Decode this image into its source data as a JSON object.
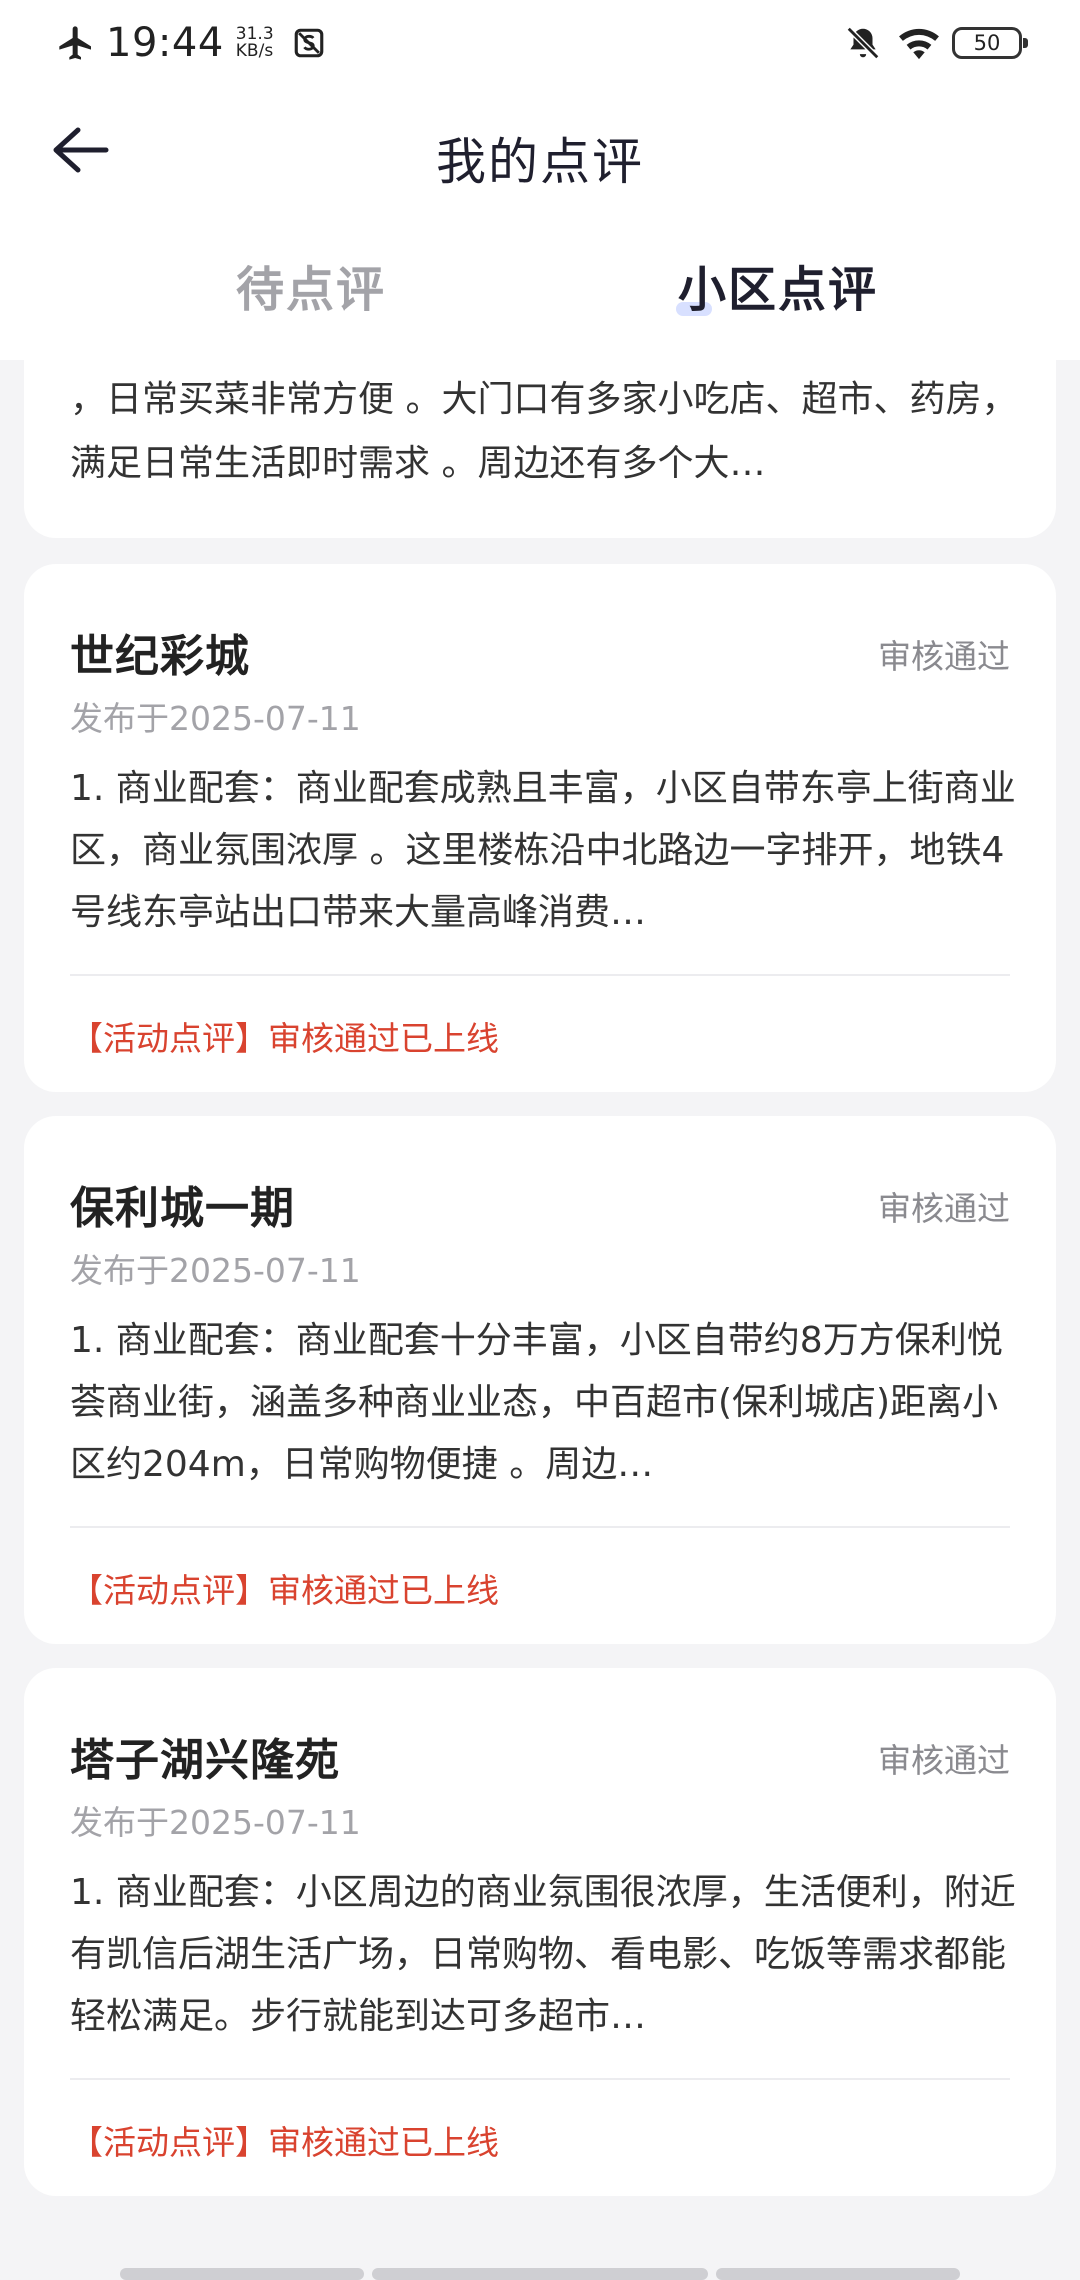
{
  "status_bar": {
    "time": "19:44",
    "speed_value": "31.3",
    "speed_unit": "KB/s",
    "battery": "50"
  },
  "nav": {
    "title": "我的点评"
  },
  "tabs": [
    {
      "label": "待点评",
      "active": false
    },
    {
      "label": "小区点评",
      "active": true
    }
  ],
  "partial_card": {
    "body": "，日常买菜非常方便 。大门口有多家小吃店、超市、药房，满足日常生活即时需求 。周边还有多个大…"
  },
  "reviews": [
    {
      "title": "世纪彩城",
      "status": "审核通过",
      "date": "发布于2025-07-11",
      "body": "1. 商业配套：商业配套成熟且丰富，小区自带东亭上街商业区，商业氛围浓厚 。这里楼栋沿中北路边一字排开，地铁4号线东亭站出口带来大量高峰消费…",
      "note": "【活动点评】审核通过已上线"
    },
    {
      "title": "保利城一期",
      "status": "审核通过",
      "date": "发布于2025-07-11",
      "body": "1. 商业配套：商业配套十分丰富，小区自带约8万方保利悦荟商业街，涵盖多种商业业态，中百超市(保利城店)距离小区约204m，日常购物便捷 。周边…",
      "note": "【活动点评】审核通过已上线"
    },
    {
      "title": "塔子湖兴隆苑",
      "status": "审核通过",
      "date": "发布于2025-07-11",
      "body": "1. 商业配套：小区周边的商业氛围很浓厚，生活便利，附近有凯信后湖生活广场，日常购物、看电影、吃饭等需求都能轻松满足。步行就能到达可多超市…",
      "note": "【活动点评】审核通过已上线"
    }
  ],
  "colors": {
    "accent_red": "#d9432f",
    "status_gray": "#8a8a8f",
    "tab_inactive": "#a3a3a8",
    "page_bg": "#f4f4f6"
  },
  "icons": {
    "back": "arrow-left-icon",
    "airplane": "airplane-icon",
    "bell_off": "bell-off-icon",
    "wifi": "wifi-icon"
  }
}
